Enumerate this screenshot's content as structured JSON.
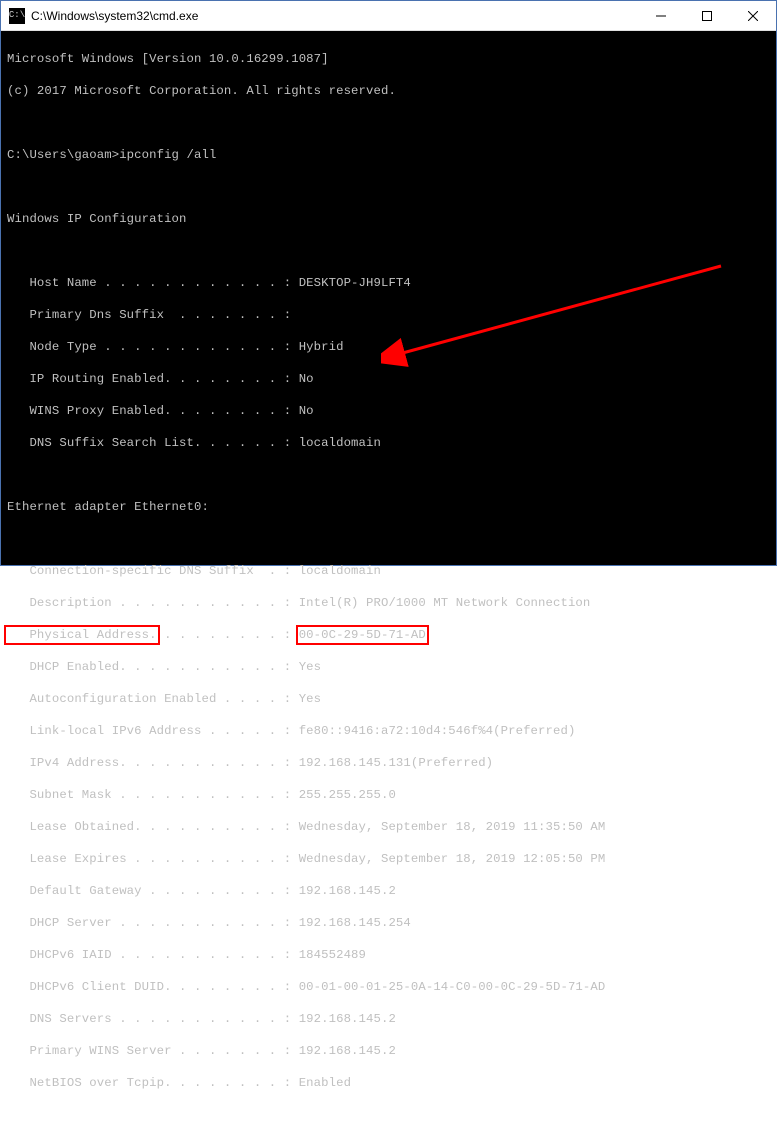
{
  "window": {
    "title": "C:\\Windows\\system32\\cmd.exe",
    "icon_label": "C:\\"
  },
  "term": {
    "banner1": "Microsoft Windows [Version 10.0.16299.1087]",
    "banner2": "(c) 2017 Microsoft Corporation. All rights reserved.",
    "prompt": "C:\\Users\\gaoam>ipconfig /all",
    "section1": "Windows IP Configuration",
    "host_name": "   Host Name . . . . . . . . . . . . : DESKTOP-JH9LFT4",
    "primary_dns": "   Primary Dns Suffix  . . . . . . . :",
    "node_type": "   Node Type . . . . . . . . . . . . : Hybrid",
    "ip_routing": "   IP Routing Enabled. . . . . . . . : No",
    "wins_proxy": "   WINS Proxy Enabled. . . . . . . . : No",
    "dns_suffix_list": "   DNS Suffix Search List. . . . . . : localdomain",
    "section2": "Ethernet adapter Ethernet0:",
    "conn_dns": "   Connection-specific DNS Suffix  . : localdomain",
    "description": "   Description . . . . . . . . . . . : Intel(R) PRO/1000 MT Network Connection",
    "phys_label": "   Physical Address.",
    "phys_dots": " . . . . . . . . : ",
    "phys_value": "00-0C-29-5D-71-AD",
    "dhcp_enabled": "   DHCP Enabled. . . . . . . . . . . : Yes",
    "autoconfig": "   Autoconfiguration Enabled . . . . : Yes",
    "ipv6": "   Link-local IPv6 Address . . . . . : fe80::9416:a72:10d4:546f%4(Preferred)",
    "ipv4": "   IPv4 Address. . . . . . . . . . . : 192.168.145.131(Preferred)",
    "subnet": "   Subnet Mask . . . . . . . . . . . : 255.255.255.0",
    "lease_obt": "   Lease Obtained. . . . . . . . . . : Wednesday, September 18, 2019 11:35:50 AM",
    "lease_exp": "   Lease Expires . . . . . . . . . . : Wednesday, September 18, 2019 12:05:50 PM",
    "gateway": "   Default Gateway . . . . . . . . . : 192.168.145.2",
    "dhcp_server": "   DHCP Server . . . . . . . . . . . : 192.168.145.254",
    "dhcpv6_iaid": "   DHCPv6 IAID . . . . . . . . . . . : 184552489",
    "dhcpv6_duid": "   DHCPv6 Client DUID. . . . . . . . : 00-01-00-01-25-0A-14-C0-00-0C-29-5D-71-AD",
    "dns_servers": "   DNS Servers . . . . . . . . . . . : 192.168.145.2",
    "primary_wins": "   Primary WINS Server . . . . . . . : 192.168.145.2",
    "netbios": "   NetBIOS over Tcpip. . . . . . . . : Enabled"
  }
}
